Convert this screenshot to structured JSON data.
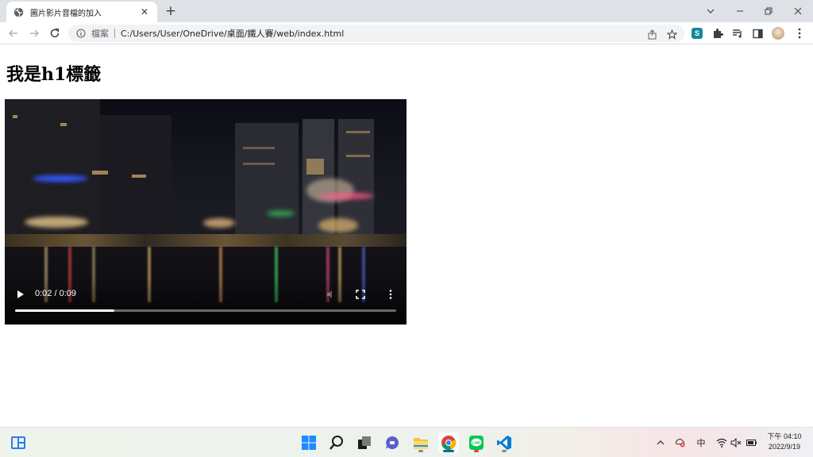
{
  "browser": {
    "tab": {
      "title": "圖片影片音檔的加入",
      "favicon": "globe-icon"
    },
    "address_bar": {
      "scheme_label": "檔案",
      "url": "C:/Users/User/OneDrive/桌面/鐵人賽/web/index.html"
    },
    "extension_badge": "S"
  },
  "page": {
    "heading": "我是h1標籤",
    "video": {
      "time_display": "0:02 / 0:09",
      "progress_fraction": 0.26,
      "state": "paused"
    }
  },
  "taskbar": {
    "pinned_apps": [
      "start",
      "search",
      "task-view",
      "chat",
      "file-explorer",
      "chrome",
      "line",
      "vscode"
    ],
    "active_app": "chrome",
    "ime_label": "中",
    "clock": {
      "time": "下午 04:10",
      "date": "2022/9/19"
    }
  },
  "colors": {
    "chrome_tabstrip": "#dee1e6",
    "omnibox_bg": "#f1f3f4",
    "accent": "#0067c0"
  }
}
